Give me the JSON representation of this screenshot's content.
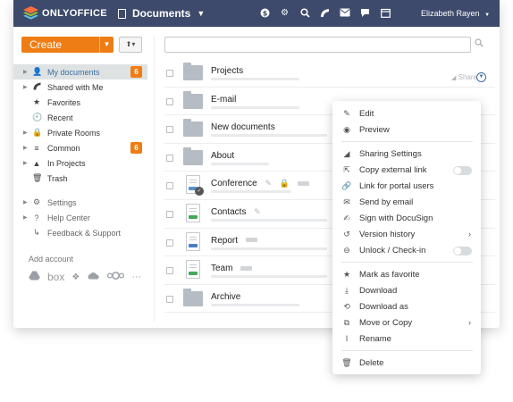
{
  "header": {
    "logo_text": "ONLYOFFICE",
    "module_label": "Documents",
    "user_name": "Elizabeth Rayen",
    "icons": [
      "currency-icon",
      "gear-icon",
      "search-icon",
      "feed-icon",
      "mail-icon",
      "chat-icon",
      "calendar-icon"
    ]
  },
  "toolbar": {
    "create_label": "Create",
    "search_placeholder": ""
  },
  "sidebar": {
    "items": [
      {
        "label": "My documents",
        "icon": "person-icon",
        "badge": "6",
        "active": true
      },
      {
        "label": "Shared with Me",
        "icon": "feed-icon"
      },
      {
        "label": "Favorites",
        "icon": "star-icon"
      },
      {
        "label": "Recent",
        "icon": "clock-icon"
      },
      {
        "label": "Private Rooms",
        "icon": "lock-icon"
      },
      {
        "label": "Common",
        "icon": "stack-icon",
        "badge": "6"
      },
      {
        "label": "In Projects",
        "icon": "triangle-icon"
      },
      {
        "label": "Trash",
        "icon": "trash-icon"
      }
    ],
    "secondary": [
      {
        "label": "Settings",
        "icon": "gear-icon"
      },
      {
        "label": "Help Center",
        "icon": "question-icon"
      },
      {
        "label": "Feedback & Support",
        "icon": "arrow-icon"
      }
    ],
    "add_account_label": "Add account",
    "services": [
      "google-drive-icon",
      "box-icon",
      "dropbox-icon",
      "onedrive-icon",
      "nextcloud-icon",
      "more-icon"
    ],
    "service_labels": {
      "box": "box",
      "more": "···"
    }
  },
  "files": [
    {
      "name": "Projects",
      "type": "folder",
      "share_label": "Share"
    },
    {
      "name": "E-mail",
      "type": "folder"
    },
    {
      "name": "New documents",
      "type": "folder"
    },
    {
      "name": "About",
      "type": "folder"
    },
    {
      "name": "Conference",
      "type": "presentation"
    },
    {
      "name": "Contacts",
      "type": "spreadsheet"
    },
    {
      "name": "Report",
      "type": "document"
    },
    {
      "name": "Team",
      "type": "spreadsheet"
    },
    {
      "name": "Archive",
      "type": "folder"
    }
  ],
  "context_menu": {
    "items": [
      {
        "label": "Edit",
        "icon": "pencil-icon"
      },
      {
        "label": "Preview",
        "icon": "eye-icon"
      },
      {
        "label": "Sharing Settings",
        "icon": "share-icon"
      },
      {
        "label": "Copy external link",
        "icon": "external-link-icon"
      },
      {
        "label": "Link for portal users",
        "icon": "link-icon"
      },
      {
        "label": "Send by email",
        "icon": "envelope-icon"
      },
      {
        "label": "Sign with DocuSign",
        "icon": "signature-icon"
      },
      {
        "label": "Version history",
        "icon": "history-icon"
      },
      {
        "label": "Unlock / Check-in",
        "icon": "unlock-icon"
      },
      {
        "label": "Mark as favorite",
        "icon": "star-icon"
      },
      {
        "label": "Download",
        "icon": "download-icon"
      },
      {
        "label": "Download as",
        "icon": "download-as-icon"
      },
      {
        "label": "Move or Copy",
        "icon": "copy-icon"
      },
      {
        "label": "Rename",
        "icon": "rename-icon"
      },
      {
        "label": "Delete",
        "icon": "trash-icon"
      }
    ]
  },
  "colors": {
    "header_bg": "#3d4a6b",
    "accent_orange": "#ef7d15",
    "link_blue": "#3a6fa0",
    "active_bg": "#dfe2e3"
  }
}
